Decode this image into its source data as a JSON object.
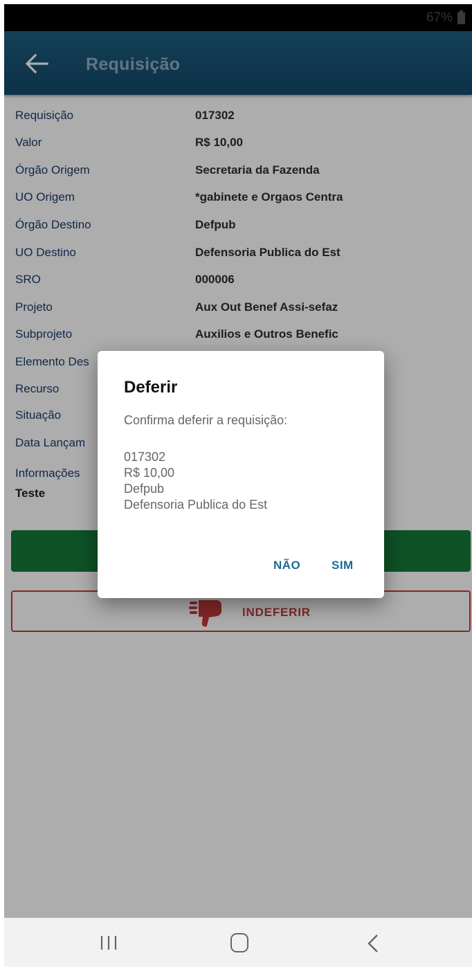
{
  "status_bar": {
    "battery": "67%"
  },
  "app_bar": {
    "title": "Requisição"
  },
  "details": [
    {
      "label": "Requisição",
      "value": "017302"
    },
    {
      "label": "Valor",
      "value": "R$ 10,00"
    },
    {
      "label": "Órgão Origem",
      "value": "Secretaria da Fazenda"
    },
    {
      "label": "UO Origem",
      "value": "*gabinete e Orgaos Centra"
    },
    {
      "label": "Órgão Destino",
      "value": "Defpub"
    },
    {
      "label": "UO Destino",
      "value": "Defensoria Publica do Est"
    },
    {
      "label": "SRO",
      "value": "000006"
    },
    {
      "label": "Projeto",
      "value": "Aux Out Benef Assi-sefaz"
    },
    {
      "label": "Subprojeto",
      "value": "Auxilios e Outros Benefic"
    },
    {
      "label": "Elemento Des",
      "value": ""
    },
    {
      "label": "Recurso",
      "value": ""
    },
    {
      "label": "Situação",
      "value": ""
    },
    {
      "label": "Data Lançam",
      "value": ""
    },
    {
      "label": "Informações ",
      "value": ""
    }
  ],
  "info_text": "Teste",
  "buttons": {
    "indeferir": "INDEFERIR"
  },
  "dialog": {
    "title": "Deferir",
    "message": "Confirma deferir a requisição:",
    "lines": [
      "017302",
      "R$ 10,00",
      "Defpub",
      "Defensoria Publica do Est"
    ],
    "no": "NÃO",
    "yes": "SIM"
  },
  "colors": {
    "app_bar": "#1d5f80",
    "deferir": "#167a38",
    "indeferir": "#c43a3a",
    "dialog_action": "#1d6a96"
  }
}
